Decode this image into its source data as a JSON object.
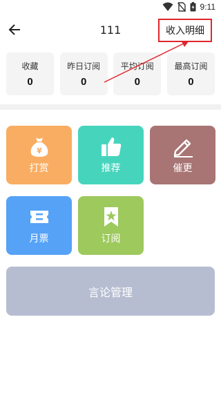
{
  "status_bar": {
    "time": "9:11",
    "icons": [
      "wifi-icon",
      "no-sim-icon",
      "battery-icon"
    ]
  },
  "header": {
    "title": "111",
    "back_icon": "arrow-left-icon",
    "income_button": "收入明细"
  },
  "stats": [
    {
      "label": "收藏",
      "value": "0"
    },
    {
      "label": "昨日订阅",
      "value": "0"
    },
    {
      "label": "平均订阅",
      "value": "0"
    },
    {
      "label": "最高订阅",
      "value": "0"
    }
  ],
  "tiles": [
    {
      "label": "打赏",
      "icon": "money-bag-icon",
      "color": "#f9ad62"
    },
    {
      "label": "推荐",
      "icon": "thumbs-up-icon",
      "color": "#47d4bd"
    },
    {
      "label": "催更",
      "icon": "pencil-icon",
      "color": "#a87474"
    },
    {
      "label": "月票",
      "icon": "ticket-icon",
      "color": "#55a2f7"
    },
    {
      "label": "订阅",
      "icon": "bookmark-star-icon",
      "color": "#9dc95d"
    }
  ],
  "speech_button": {
    "label": "言论管理",
    "color": "#b7bdd1"
  },
  "annotation": {
    "color": "#e0262c"
  }
}
